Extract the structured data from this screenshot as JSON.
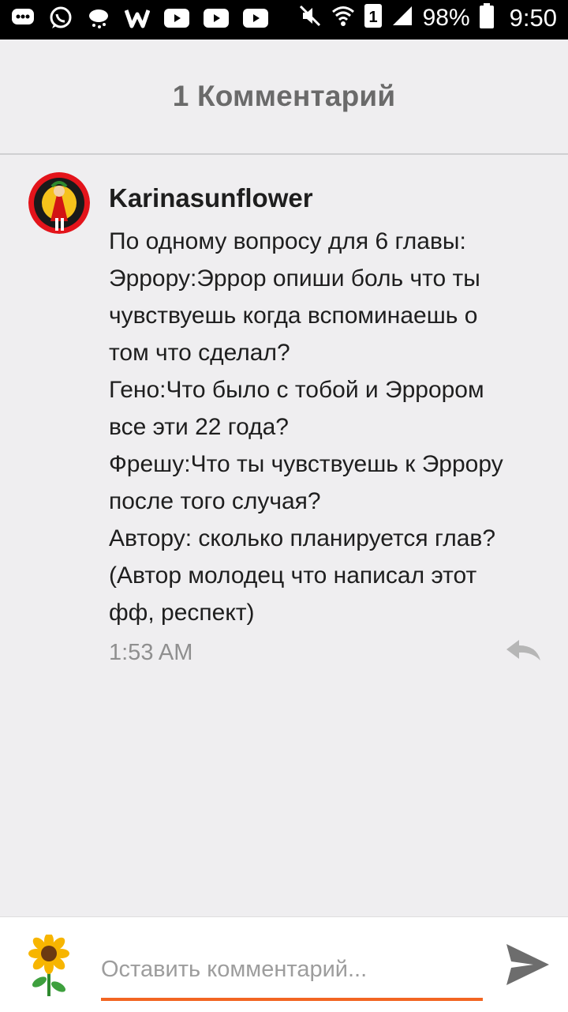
{
  "status_bar": {
    "battery_percent": "98%",
    "time": "9:50",
    "sim_slot": "1",
    "icons": [
      "chat-bubble-icon",
      "whatsapp-icon",
      "weather-icon",
      "w-app-icon",
      "youtube-icon",
      "youtube-icon",
      "youtube-icon",
      "mute-icon",
      "wifi-icon",
      "sim-icon",
      "signal-icon",
      "battery-icon"
    ]
  },
  "header": {
    "title": "1 Комментарий"
  },
  "comment": {
    "author": "Karinasunflower",
    "lines": [
      "По одному вопросу для 6 главы:",
      "Эррору:Эррор опиши боль что ты",
      "чувствуешь когда вспоминаешь о",
      "том что сделал?",
      "Гено:Что было с тобой и Эррором",
      "все эти 22 года?",
      "Фрешу:Что ты чувствуешь к Эррору",
      "после того случая?",
      "Автору: сколько планируется глав?",
      "(Автор молодец что написал этот",
      "фф, респект)"
    ],
    "time": "1:53 AM",
    "reply_icon": "reply-icon"
  },
  "composer": {
    "placeholder": "Оставить комментарий...",
    "value": "",
    "send_icon": "send-icon",
    "avatar_icon": "sunflower-icon"
  },
  "colors": {
    "accent": "#f26522",
    "background": "#efeef0"
  }
}
